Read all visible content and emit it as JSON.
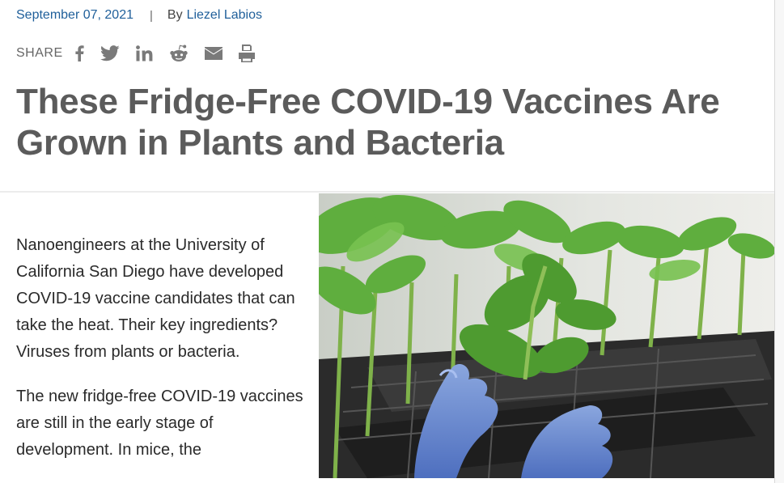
{
  "article": {
    "date": "September 07, 2021",
    "separator": "|",
    "by_prefix": "By",
    "author": "Liezel Labios",
    "title": "These Fridge-Free COVID-19 Vaccines Are Grown in Plants and Bacteria",
    "paragraphs": [
      "Nanoengineers at the University of California San Diego have developed COVID-19 vaccine candidates that can take the heat. Their key ingredients? Viruses from plants or bacteria.",
      "The new fridge-free COVID-19 vaccines are still in the early stage of development. In mice, the"
    ]
  },
  "share": {
    "label": "SHARE",
    "icons": [
      "facebook-icon",
      "twitter-icon",
      "linkedin-icon",
      "reddit-icon",
      "email-icon",
      "print-icon"
    ]
  },
  "colors": {
    "link": "#1f5f9a",
    "title": "#5b5b5b",
    "icon": "#7a7a7a",
    "glove": "#6f8fd0",
    "leaf": "#5fae3e"
  }
}
